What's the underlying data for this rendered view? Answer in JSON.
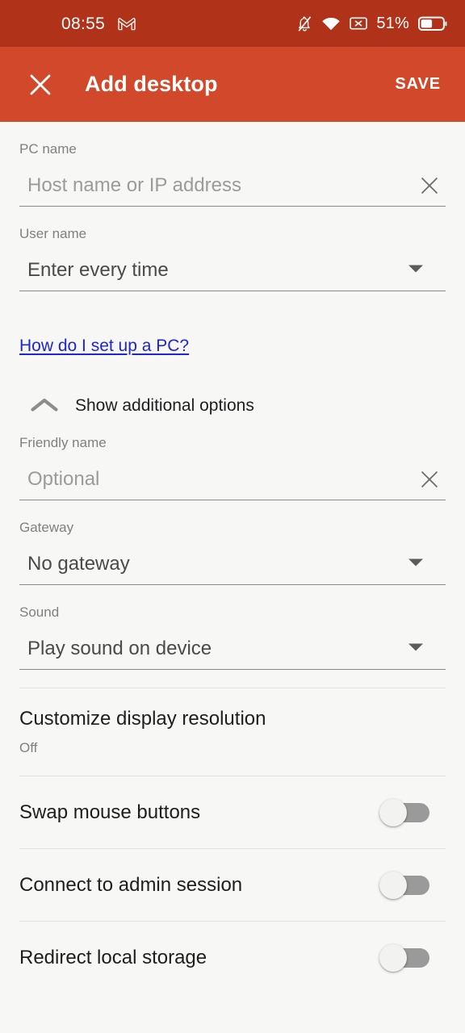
{
  "status_bar": {
    "time": "08:55",
    "app_icon": "gmail-icon",
    "icons": [
      "notifications-silenced-icon",
      "wifi-icon",
      "no-sim-icon"
    ],
    "battery_percent": "51%",
    "background_color": "#b03218"
  },
  "app_bar": {
    "close_label": "close-icon",
    "title": "Add desktop",
    "save_label": "SAVE",
    "background_color": "#d1492a"
  },
  "form": {
    "pc_name": {
      "label": "PC name",
      "placeholder": "Host name or IP address",
      "value": "",
      "clear_icon": "clear-icon"
    },
    "user_name": {
      "label": "User name",
      "value": "Enter every time",
      "dropdown_icon": "chevron-down-icon"
    },
    "help_link": "How do I set up a PC?",
    "additional_options": {
      "label": "Show additional options",
      "expanded": true,
      "chevron_icon": "chevron-up-icon"
    },
    "friendly_name": {
      "label": "Friendly name",
      "placeholder": "Optional",
      "value": "",
      "clear_icon": "clear-icon"
    },
    "gateway": {
      "label": "Gateway",
      "value": "No gateway",
      "dropdown_icon": "chevron-down-icon"
    },
    "sound": {
      "label": "Sound",
      "value": "Play sound on device",
      "dropdown_icon": "chevron-down-icon"
    },
    "display_resolution": {
      "title": "Customize display resolution",
      "subtitle": "Off"
    },
    "toggles": [
      {
        "label": "Swap mouse buttons",
        "checked": false
      },
      {
        "label": "Connect to admin session",
        "checked": false
      },
      {
        "label": "Redirect local storage",
        "checked": false
      }
    ]
  },
  "colors": {
    "accent": "#d1492a",
    "status_bar": "#b03218",
    "link": "#1f25cf",
    "page_background": "#f7f7f6",
    "divider": "#e2e2e1"
  }
}
